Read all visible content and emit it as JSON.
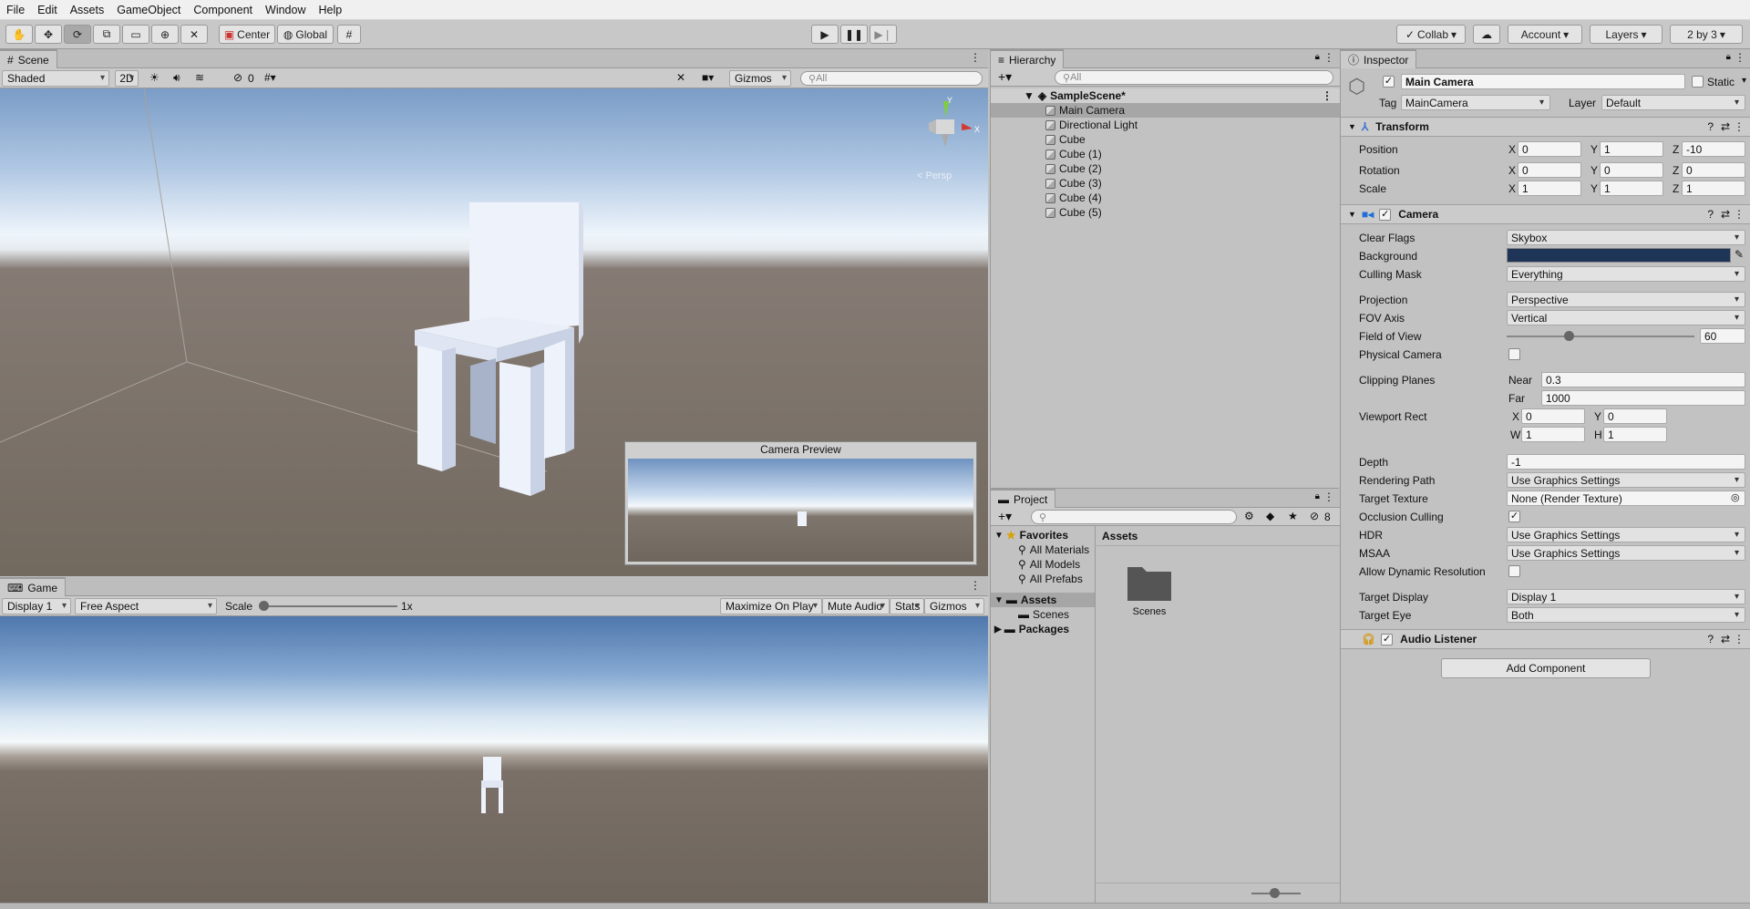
{
  "menu": [
    "File",
    "Edit",
    "Assets",
    "GameObject",
    "Component",
    "Window",
    "Help"
  ],
  "toolbar": {
    "center": "Center",
    "global": "Global",
    "collab": "Collab",
    "account": "Account",
    "layers": "Layers",
    "layout": "2 by 3"
  },
  "scene": {
    "tab": "Scene",
    "shading": "Shaded",
    "mode2d": "2D",
    "hidden_count": "0",
    "gizmos": "Gizmos",
    "search_placeholder": "All",
    "persp_label": "< Persp",
    "camera_preview_title": "Camera Preview"
  },
  "game": {
    "tab": "Game",
    "display": "Display 1",
    "aspect": "Free Aspect",
    "scale_label": "Scale",
    "scale_value": "1x",
    "maximize": "Maximize On Play",
    "mute": "Mute Audio",
    "stats": "Stats",
    "gizmos": "Gizmos"
  },
  "hierarchy": {
    "tab": "Hierarchy",
    "search_placeholder": "All",
    "scene_name": "SampleScene*",
    "items": [
      "Main Camera",
      "Directional Light",
      "Cube",
      "Cube (1)",
      "Cube (2)",
      "Cube (3)",
      "Cube (4)",
      "Cube (5)"
    ]
  },
  "project": {
    "tab": "Project",
    "hidden_count": "8",
    "favorites": "Favorites",
    "favorite_items": [
      "All Materials",
      "All Models",
      "All Prefabs"
    ],
    "assets": "Assets",
    "scenes": "Scenes",
    "packages": "Packages",
    "breadcrumb": "Assets",
    "folder_label": "Scenes"
  },
  "inspector": {
    "tab": "Inspector",
    "object_name": "Main Camera",
    "static_label": "Static",
    "tag_label": "Tag",
    "tag_value": "MainCamera",
    "layer_label": "Layer",
    "layer_value": "Default",
    "transform": {
      "title": "Transform",
      "position_label": "Position",
      "position": [
        "0",
        "1",
        "-10"
      ],
      "rotation_label": "Rotation",
      "rotation": [
        "0",
        "0",
        "0"
      ],
      "scale_label": "Scale",
      "scale": [
        "1",
        "1",
        "1"
      ]
    },
    "camera": {
      "title": "Camera",
      "clear_flags_label": "Clear Flags",
      "clear_flags": "Skybox",
      "background_label": "Background",
      "background_color": "#1e3557",
      "culling_mask_label": "Culling Mask",
      "culling_mask": "Everything",
      "projection_label": "Projection",
      "projection": "Perspective",
      "fov_axis_label": "FOV Axis",
      "fov_axis": "Vertical",
      "fov_label": "Field of View",
      "fov": "60",
      "fov_level": 0.33,
      "physical_label": "Physical Camera",
      "clipping_label": "Clipping Planes",
      "near_label": "Near",
      "near": "0.3",
      "far_label": "Far",
      "far": "1000",
      "viewport_label": "Viewport Rect",
      "vp_x": "0",
      "vp_y": "0",
      "vp_w": "1",
      "vp_h": "1",
      "depth_label": "Depth",
      "depth": "-1",
      "rendering_path_label": "Rendering Path",
      "rendering_path": "Use Graphics Settings",
      "target_texture_label": "Target Texture",
      "target_texture": "None (Render Texture)",
      "occlusion_label": "Occlusion Culling",
      "hdr_label": "HDR",
      "hdr": "Use Graphics Settings",
      "msaa_label": "MSAA",
      "msaa": "Use Graphics Settings",
      "dynres_label": "Allow Dynamic Resolution",
      "target_display_label": "Target Display",
      "target_display": "Display 1",
      "target_eye_label": "Target Eye",
      "target_eye": "Both"
    },
    "audio_listener": "Audio Listener",
    "add_component": "Add Component"
  },
  "axis_letters": {
    "x": "X",
    "y": "Y",
    "z": "Z",
    "w": "W",
    "h": "H"
  },
  "colors": {
    "accent": "#1e3557",
    "selection": "#a6a6a6"
  }
}
